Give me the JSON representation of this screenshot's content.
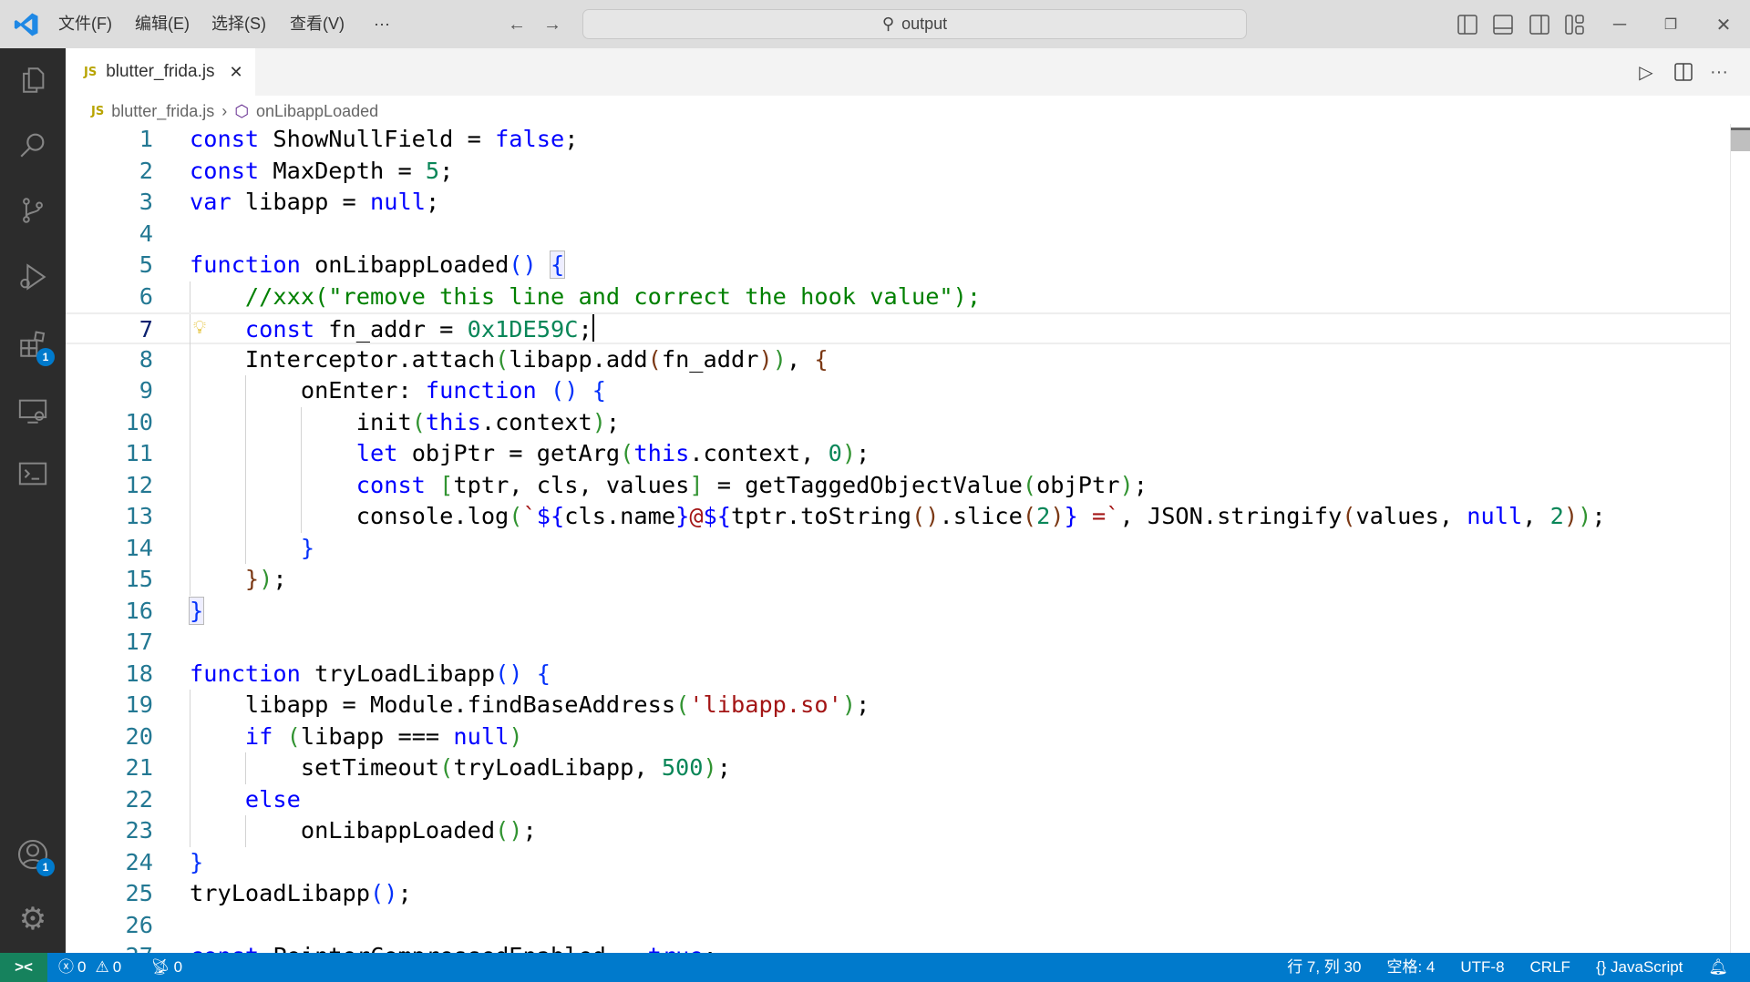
{
  "titlebar": {
    "menus": [
      "文件(F)",
      "编辑(E)",
      "选择(S)",
      "查看(V)",
      "···"
    ],
    "search": "output",
    "icons": [
      "toggle-primary-sidebar-icon",
      "toggle-panel-icon",
      "toggle-secondary-sidebar-icon",
      "customize-layout-icon",
      "minimize-icon",
      "restore-icon",
      "close-icon"
    ]
  },
  "activity": {
    "items": [
      "explorer",
      "search",
      "source-control",
      "run-debug",
      "extensions",
      "remote-explorer",
      "terminal"
    ],
    "extensions_badge": "1",
    "accounts_badge": "1"
  },
  "tab": {
    "icon": "JS",
    "label": "blutter_frida.js"
  },
  "breadcrumb": {
    "file_icon": "JS",
    "file": "blutter_frida.js",
    "symbol": "onLibappLoaded"
  },
  "editor": {
    "current_line": 7,
    "cursor_column": 30,
    "lines": [
      [
        [
          "const",
          "k"
        ],
        [
          " ShowNullField = ",
          ""
        ],
        [
          "false",
          "k"
        ],
        [
          ";",
          ""
        ]
      ],
      [
        [
          "const",
          "k"
        ],
        [
          " MaxDepth = ",
          ""
        ],
        [
          "5",
          "n"
        ],
        [
          ";",
          ""
        ]
      ],
      [
        [
          "var",
          "k"
        ],
        [
          " libapp = ",
          ""
        ],
        [
          "null",
          "k"
        ],
        [
          ";",
          ""
        ]
      ],
      [],
      [
        [
          "function",
          "k"
        ],
        [
          " onLibappLoaded",
          ""
        ],
        [
          "()",
          "b1"
        ],
        [
          " ",
          ""
        ],
        [
          "{",
          "b1 boxed"
        ]
      ],
      [
        [
          "    ",
          ""
        ],
        [
          "//xxx(\"remove this line and correct the hook value\");",
          "c"
        ]
      ],
      [
        [
          "    ",
          ""
        ],
        [
          "const",
          "k"
        ],
        [
          " fn_addr = ",
          ""
        ],
        [
          "0x1DE59C",
          "n"
        ],
        [
          ";",
          ""
        ]
      ],
      [
        [
          "    Interceptor.attach",
          ""
        ],
        [
          "(",
          "b2"
        ],
        [
          "libapp.add",
          ""
        ],
        [
          "(",
          "b3"
        ],
        [
          "fn_addr",
          ""
        ],
        [
          ")",
          "b3"
        ],
        [
          ")",
          "b2"
        ],
        [
          ", ",
          ""
        ],
        [
          "{",
          "b3"
        ]
      ],
      [
        [
          "        onEnter: ",
          ""
        ],
        [
          "function",
          "k"
        ],
        [
          " ",
          ""
        ],
        [
          "()",
          "b1"
        ],
        [
          " ",
          ""
        ],
        [
          "{",
          "b1"
        ]
      ],
      [
        [
          "            init",
          ""
        ],
        [
          "(",
          "b2"
        ],
        [
          "this",
          "k"
        ],
        [
          ".context",
          ""
        ],
        [
          ")",
          "b2"
        ],
        [
          ";",
          ""
        ]
      ],
      [
        [
          "            ",
          ""
        ],
        [
          "let",
          "k"
        ],
        [
          " objPtr = getArg",
          ""
        ],
        [
          "(",
          "b2"
        ],
        [
          "this",
          "k"
        ],
        [
          ".context, ",
          ""
        ],
        [
          "0",
          "n"
        ],
        [
          ")",
          "b2"
        ],
        [
          ";",
          ""
        ]
      ],
      [
        [
          "            ",
          ""
        ],
        [
          "const",
          "k"
        ],
        [
          " ",
          ""
        ],
        [
          "[",
          "b2"
        ],
        [
          "tptr, cls, values",
          ""
        ],
        [
          "]",
          "b2"
        ],
        [
          " = getTaggedObjectValue",
          ""
        ],
        [
          "(",
          "b2"
        ],
        [
          "objPtr",
          ""
        ],
        [
          ")",
          "b2"
        ],
        [
          ";",
          ""
        ]
      ],
      [
        [
          "            console.log",
          ""
        ],
        [
          "(",
          "b2"
        ],
        [
          "`",
          "s"
        ],
        [
          "${",
          "k"
        ],
        [
          "cls.name",
          ""
        ],
        [
          "}",
          "k"
        ],
        [
          "@",
          "s"
        ],
        [
          "${",
          "k"
        ],
        [
          "tptr.toString",
          ""
        ],
        [
          "()",
          "b3"
        ],
        [
          ".slice",
          ""
        ],
        [
          "(",
          "b3"
        ],
        [
          "2",
          "n"
        ],
        [
          ")",
          "b3"
        ],
        [
          "}",
          "k"
        ],
        [
          " =`",
          "s"
        ],
        [
          ", JSON.stringify",
          ""
        ],
        [
          "(",
          "b3"
        ],
        [
          "values, ",
          ""
        ],
        [
          "null",
          "k"
        ],
        [
          ", ",
          ""
        ],
        [
          "2",
          "n"
        ],
        [
          ")",
          "b3"
        ],
        [
          ")",
          "b2"
        ],
        [
          ";",
          ""
        ]
      ],
      [
        [
          "        ",
          ""
        ],
        [
          "}",
          "b1"
        ]
      ],
      [
        [
          "    ",
          ""
        ],
        [
          "}",
          "b3"
        ],
        [
          ")",
          "b2"
        ],
        [
          ";",
          ""
        ]
      ],
      [
        [
          "}",
          "b1 boxed"
        ]
      ],
      [],
      [
        [
          "function",
          "k"
        ],
        [
          " tryLoadLibapp",
          ""
        ],
        [
          "()",
          "b1"
        ],
        [
          " ",
          ""
        ],
        [
          "{",
          "b1"
        ]
      ],
      [
        [
          "    libapp = Module.findBaseAddress",
          ""
        ],
        [
          "(",
          "b2"
        ],
        [
          "'libapp.so'",
          "s"
        ],
        [
          ")",
          "b2"
        ],
        [
          ";",
          ""
        ]
      ],
      [
        [
          "    ",
          ""
        ],
        [
          "if",
          "k"
        ],
        [
          " ",
          ""
        ],
        [
          "(",
          "b2"
        ],
        [
          "libapp === ",
          ""
        ],
        [
          "null",
          "k"
        ],
        [
          ")",
          "b2"
        ]
      ],
      [
        [
          "        setTimeout",
          ""
        ],
        [
          "(",
          "b2"
        ],
        [
          "tryLoadLibapp, ",
          ""
        ],
        [
          "500",
          "n"
        ],
        [
          ")",
          "b2"
        ],
        [
          ";",
          ""
        ]
      ],
      [
        [
          "    ",
          ""
        ],
        [
          "else",
          "k"
        ]
      ],
      [
        [
          "        onLibappLoaded",
          ""
        ],
        [
          "()",
          "b2"
        ],
        [
          ";",
          ""
        ]
      ],
      [
        [
          "}",
          "b1"
        ]
      ],
      [
        [
          "tryLoadLibapp",
          ""
        ],
        [
          "()",
          "b1"
        ],
        [
          ";",
          ""
        ]
      ],
      [],
      [
        [
          "const",
          "k"
        ],
        [
          " PointerCompressedEnabled = ",
          ""
        ],
        [
          "true",
          "k"
        ],
        [
          ";",
          ""
        ]
      ]
    ]
  },
  "statusbar": {
    "errors": "0",
    "warnings": "0",
    "ports": "0",
    "position": "行 7, 列 30",
    "indent": "空格: 4",
    "encoding": "UTF-8",
    "eol": "CRLF",
    "language": "JavaScript"
  },
  "colors": {
    "accent": "#007acc",
    "remote": "#16825d",
    "keyword": "#0000ff",
    "number": "#098658",
    "string": "#a31515",
    "comment": "#008000"
  }
}
